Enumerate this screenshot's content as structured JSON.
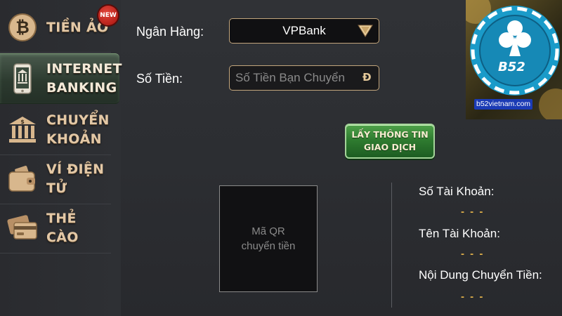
{
  "sidebar": {
    "items": [
      {
        "label": "TIỀN ẢO",
        "icon": "bitcoin-icon",
        "badge": "NEW",
        "active": false
      },
      {
        "label": "INTERNET\nBANKING",
        "icon": "mobile-bank-icon",
        "active": true
      },
      {
        "label": "CHUYỂN\nKHOẢN",
        "icon": "bank-icon",
        "active": false
      },
      {
        "label": "VÍ ĐIỆN TỬ",
        "icon": "wallet-icon",
        "active": false
      },
      {
        "label": "THẺ CÀO",
        "icon": "card-icon",
        "active": false
      }
    ]
  },
  "form": {
    "bank_label": "Ngân Hàng:",
    "bank_value": "VPBank",
    "amount_label": "Số Tiền:",
    "amount_placeholder": "Số Tiền Bạn Chuyển",
    "currency_symbol": "Đ",
    "get_info_button": "LẤY THÔNG TIN\nGIAO DỊCH"
  },
  "qr": {
    "placeholder": "Mã QR\nchuyển tiền"
  },
  "info": {
    "account_number_label": "Số Tài Khoản:",
    "account_number_value": "- - -",
    "account_name_label": "Tên Tài Khoản:",
    "account_name_value": "- - -",
    "transfer_content_label": "Nội Dung Chuyển Tiền:",
    "transfer_content_value": "- - -"
  },
  "logo": {
    "brand": "B52",
    "site": "b52vietnam.com",
    "icon": "club-suit-icon"
  },
  "colors": {
    "accent_gold": "#c2a57c",
    "button_green": "#2f7c30",
    "value_gold": "#e0b04a",
    "active_tab": "#2c3a2f"
  }
}
